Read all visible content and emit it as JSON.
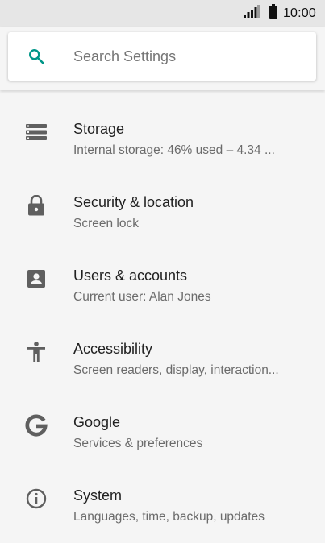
{
  "status_bar": {
    "time": "10:00"
  },
  "search": {
    "placeholder": "Search Settings"
  },
  "colors": {
    "accent": "#009688",
    "icon": "#5f5f5f"
  },
  "settings": [
    {
      "icon": "storage-icon",
      "title": "Storage",
      "subtitle": "Internal storage: 46% used – 4.34 ..."
    },
    {
      "icon": "lock-icon",
      "title": "Security & location",
      "subtitle": "Screen lock"
    },
    {
      "icon": "account-box-icon",
      "title": "Users & accounts",
      "subtitle": "Current user: Alan Jones"
    },
    {
      "icon": "accessibility-icon",
      "title": "Accessibility",
      "subtitle": "Screen readers, display, interaction..."
    },
    {
      "icon": "google-icon",
      "title": "Google",
      "subtitle": "Services & preferences"
    },
    {
      "icon": "info-icon",
      "title": "System",
      "subtitle": "Languages, time, backup, updates"
    }
  ]
}
